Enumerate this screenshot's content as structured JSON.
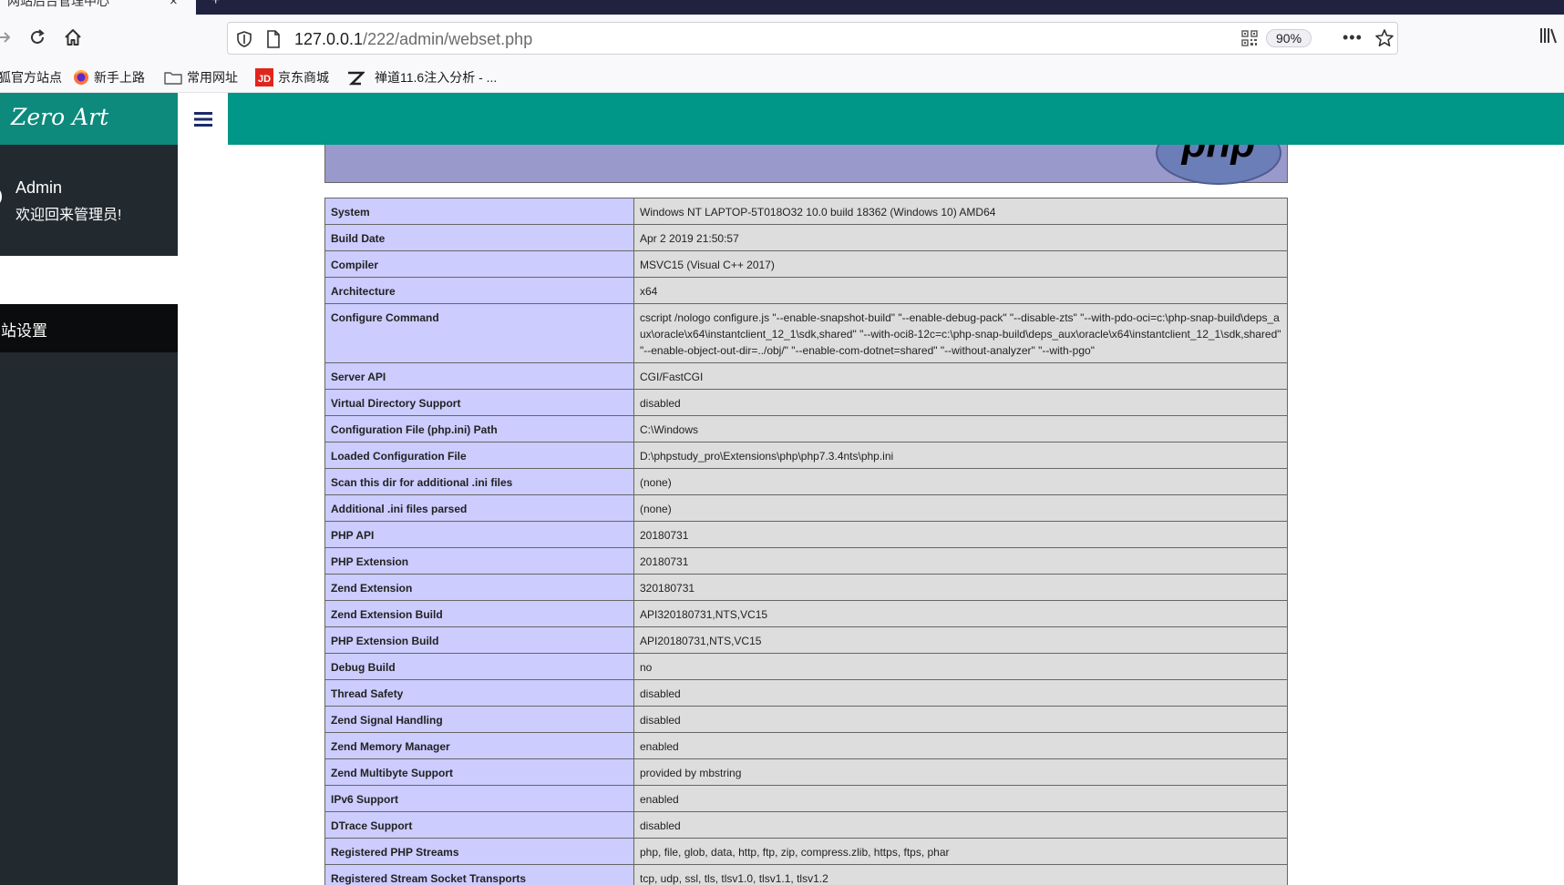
{
  "browser": {
    "tab_title": "网站后台管理中心",
    "url_host": "127.0.0.1",
    "url_path": "/222/admin/webset.php",
    "zoom": "90%",
    "bookmarks": [
      {
        "label": "火狐官方站点",
        "icon": "firefox-icon"
      },
      {
        "label": "新手上路",
        "icon": "firefox-icon"
      },
      {
        "label": "常用网址",
        "icon": "folder-icon"
      },
      {
        "label": "京东商城",
        "icon": "jd-icon"
      },
      {
        "label": "禅道11.6注入分析 - ...",
        "icon": "zentao-icon"
      }
    ]
  },
  "app": {
    "logo_text": "Zero Art",
    "user_name": "Admin",
    "welcome": "欢迎回来管理员!",
    "menu_item": "网站设置",
    "colors": {
      "topbar": "#009688",
      "sidebar": "#22292f",
      "php_key": "#ccccff",
      "php_value": "#dddddd",
      "php_header": "#9999cc"
    }
  },
  "phpinfo": [
    {
      "key": "System",
      "value": "Windows NT LAPTOP-5T018O32 10.0 build 18362 (Windows 10) AMD64"
    },
    {
      "key": "Build Date",
      "value": "Apr 2 2019 21:50:57"
    },
    {
      "key": "Compiler",
      "value": "MSVC15 (Visual C++ 2017)"
    },
    {
      "key": "Architecture",
      "value": "x64"
    },
    {
      "key": "Configure Command",
      "value": "cscript /nologo configure.js \"--enable-snapshot-build\" \"--enable-debug-pack\" \"--disable-zts\" \"--with-pdo-oci=c:\\php-snap-build\\deps_aux\\oracle\\x64\\instantclient_12_1\\sdk,shared\" \"--with-oci8-12c=c:\\php-snap-build\\deps_aux\\oracle\\x64\\instantclient_12_1\\sdk,shared\" \"--enable-object-out-dir=../obj/\" \"--enable-com-dotnet=shared\" \"--without-analyzer\" \"--with-pgo\""
    },
    {
      "key": "Server API",
      "value": "CGI/FastCGI"
    },
    {
      "key": "Virtual Directory Support",
      "value": "disabled"
    },
    {
      "key": "Configuration File (php.ini) Path",
      "value": "C:\\Windows"
    },
    {
      "key": "Loaded Configuration File",
      "value": "D:\\phpstudy_pro\\Extensions\\php\\php7.3.4nts\\php.ini"
    },
    {
      "key": "Scan this dir for additional .ini files",
      "value": "(none)"
    },
    {
      "key": "Additional .ini files parsed",
      "value": "(none)"
    },
    {
      "key": "PHP API",
      "value": "20180731"
    },
    {
      "key": "PHP Extension",
      "value": "20180731"
    },
    {
      "key": "Zend Extension",
      "value": "320180731"
    },
    {
      "key": "Zend Extension Build",
      "value": "API320180731,NTS,VC15"
    },
    {
      "key": "PHP Extension Build",
      "value": "API20180731,NTS,VC15"
    },
    {
      "key": "Debug Build",
      "value": "no"
    },
    {
      "key": "Thread Safety",
      "value": "disabled"
    },
    {
      "key": "Zend Signal Handling",
      "value": "disabled"
    },
    {
      "key": "Zend Memory Manager",
      "value": "enabled"
    },
    {
      "key": "Zend Multibyte Support",
      "value": "provided by mbstring"
    },
    {
      "key": "IPv6 Support",
      "value": "enabled"
    },
    {
      "key": "DTrace Support",
      "value": "disabled"
    },
    {
      "key": "Registered PHP Streams",
      "value": "php, file, glob, data, http, ftp, zip, compress.zlib, https, ftps, phar"
    },
    {
      "key": "Registered Stream Socket Transports",
      "value": "tcp, udp, ssl, tls, tlsv1.0, tlsv1.1, tlsv1.2"
    }
  ]
}
